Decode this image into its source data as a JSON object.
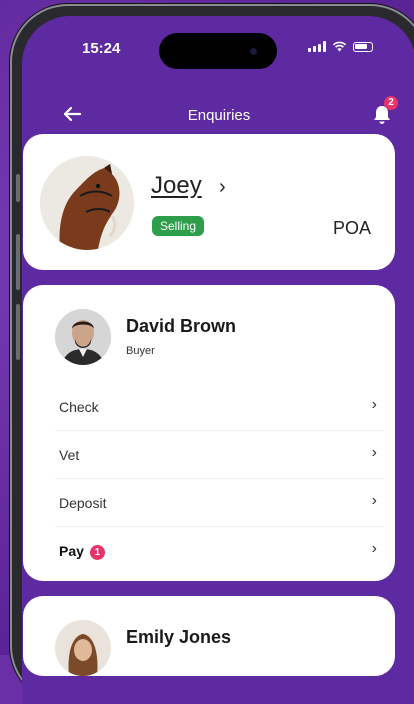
{
  "status_bar": {
    "time": "15:24"
  },
  "nav": {
    "title": "Enquiries",
    "notification_count": "2"
  },
  "horse": {
    "name": "Joey",
    "status": "Selling",
    "price": "POA"
  },
  "enquiries": [
    {
      "name": "David Brown",
      "role": "Buyer",
      "steps": [
        {
          "label": "Check"
        },
        {
          "label": "Vet"
        },
        {
          "label": "Deposit"
        },
        {
          "label": "Pay",
          "badge": "1"
        }
      ]
    },
    {
      "name": "Emily Jones"
    }
  ],
  "icons": {
    "back": "arrow-left-icon",
    "notifications": "bell-icon",
    "chevron": "chevron-right-icon"
  },
  "colors": {
    "background": "#5e2aa1",
    "badge": "#e8336a",
    "selling": "#2e9e4a"
  }
}
